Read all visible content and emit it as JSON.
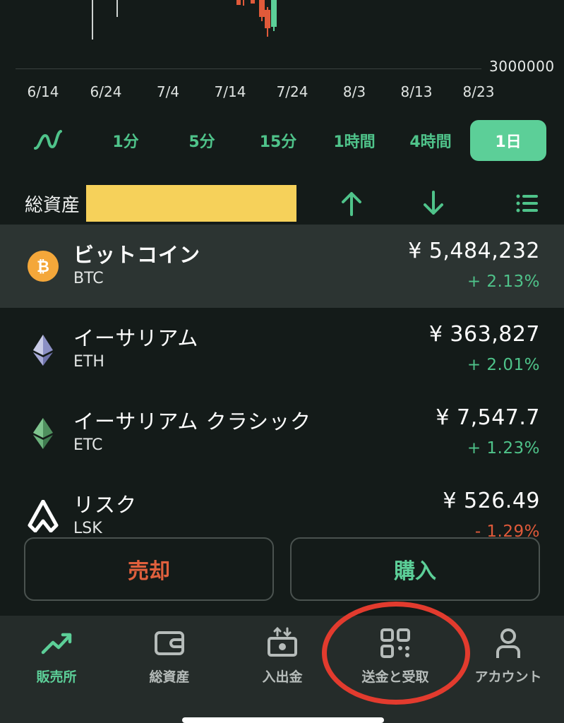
{
  "chart": {
    "price_label": "3000000",
    "dates": [
      "6/14",
      "6/24",
      "7/4",
      "7/14",
      "7/24",
      "8/3",
      "8/13",
      "8/23"
    ]
  },
  "timeframes": {
    "line_icon": "line-chart-icon",
    "items": [
      "1分",
      "5分",
      "15分",
      "1時間",
      "4時間",
      "1日"
    ],
    "active": "1日"
  },
  "asset_header": {
    "title": "総資産",
    "icons": [
      "arrow-up-icon",
      "arrow-down-icon",
      "list-icon"
    ]
  },
  "coins": [
    {
      "name": "ビットコイン",
      "symbol": "BTC",
      "price": "¥ 5,484,232",
      "change": "+ 2.13%",
      "icon": "bitcoin-icon"
    },
    {
      "name": "イーサリアム",
      "symbol": "ETH",
      "price": "¥ 363,827",
      "change": "+ 2.01%",
      "icon": "ethereum-icon"
    },
    {
      "name": "イーサリアム クラシック",
      "symbol": "ETC",
      "price": "¥ 7,547.7",
      "change": "+ 1.23%",
      "icon": "ethereum-classic-icon"
    },
    {
      "name": "リスク",
      "symbol": "LSK",
      "price": "¥ 526.49",
      "change": "- 1.29%",
      "icon": "lisk-icon"
    }
  ],
  "actions": {
    "sell": "売却",
    "buy": "購入"
  },
  "nav": {
    "items": [
      {
        "label": "販売所",
        "icon": "trend-icon"
      },
      {
        "label": "総資産",
        "icon": "wallet-icon"
      },
      {
        "label": "入出金",
        "icon": "deposit-icon"
      },
      {
        "label": "送金と受取",
        "icon": "qr-icon"
      },
      {
        "label": "アカウント",
        "icon": "account-icon"
      }
    ]
  },
  "colors": {
    "background": "#141b19",
    "accent_green": "#5ccf98",
    "negative_red": "#e05a3a",
    "highlight_circle": "#e23b2e"
  }
}
